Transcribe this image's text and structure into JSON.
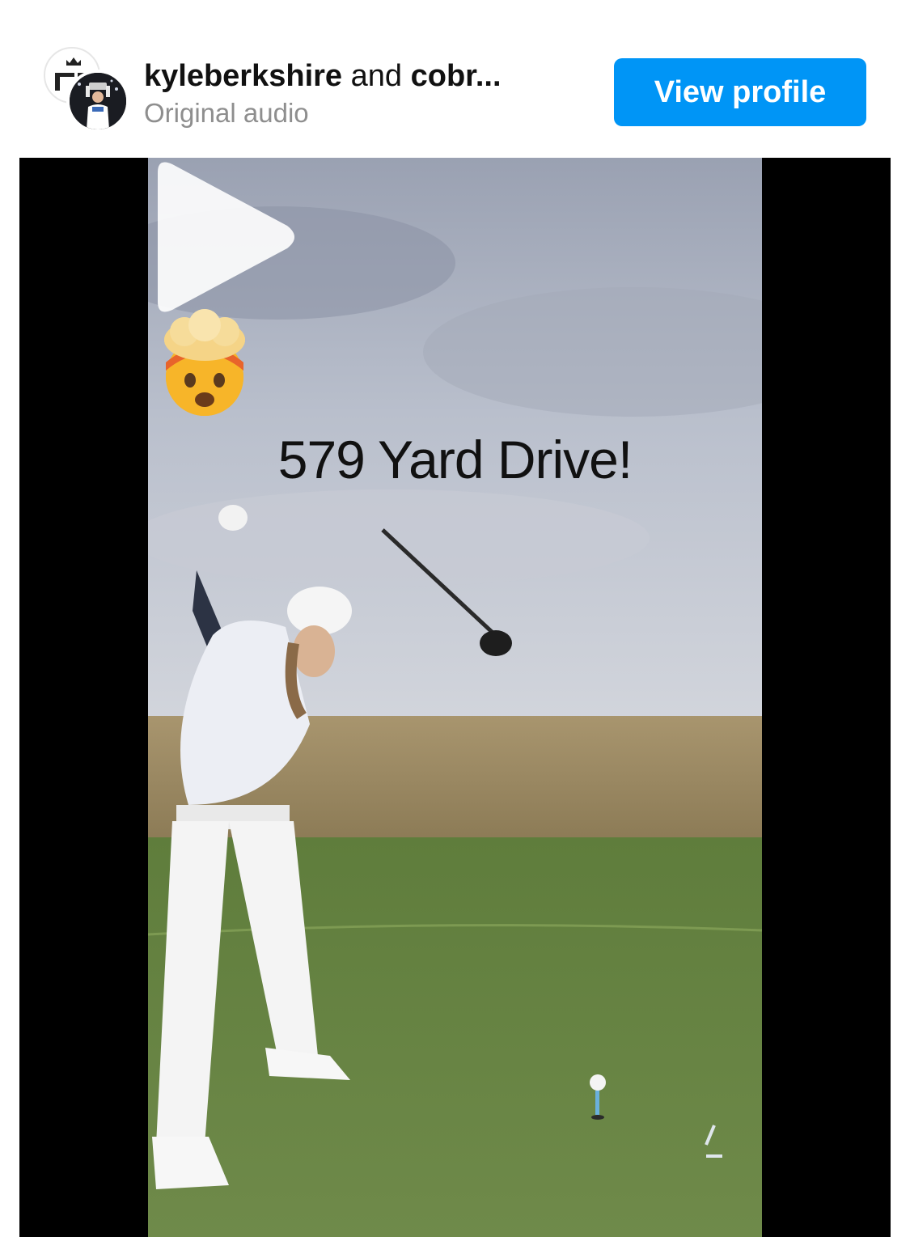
{
  "header": {
    "user_primary": "kyleberkshire",
    "joiner": "and",
    "user_secondary": "cobr...",
    "subtitle": "Original audio",
    "view_profile_label": "View profile"
  },
  "post": {
    "caption": "579 Yard Drive!",
    "emojis": [
      "exploding-head",
      "exploding-head"
    ]
  },
  "colors": {
    "accent": "#0095f6",
    "subtitle": "#8e8e8e",
    "letterbox": "#000000"
  }
}
